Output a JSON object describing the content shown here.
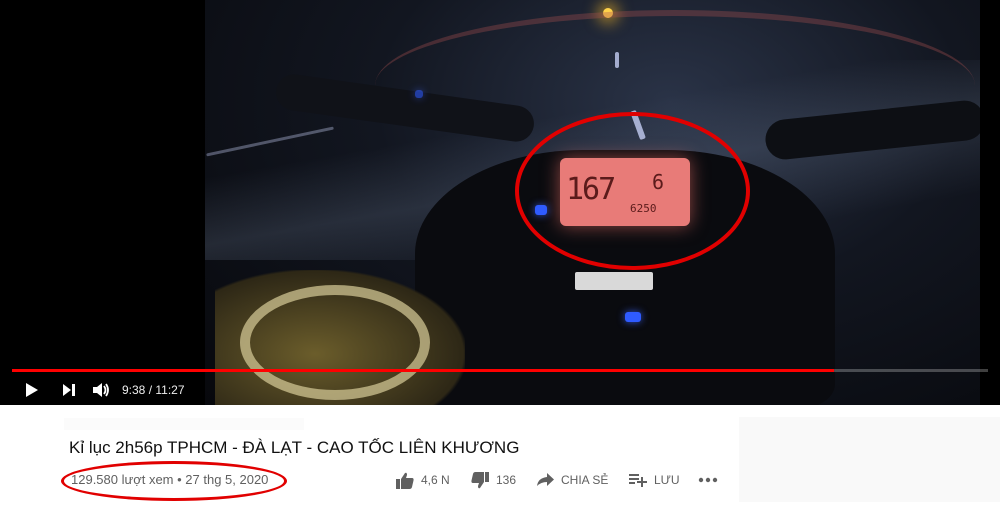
{
  "player": {
    "current_time": "9:38",
    "duration": "11:27",
    "time_display": "9:38 / 11:27",
    "progress_fraction": 0.842,
    "dashboard": {
      "speed": "167",
      "gear": "6",
      "rpm": "6250"
    }
  },
  "video": {
    "title": "Kỉ lục 2h56p TPHCM - ĐÀ LẠT - CAO TỐC LIÊN KHƯƠNG",
    "meta": "129.580 lượt xem • 27 thg 5, 2020"
  },
  "actions": {
    "like_count": "4,6 N",
    "dislike_count": "136",
    "share_label": "CHIA SẺ",
    "save_label": "LƯU"
  },
  "colors": {
    "accent": "#ff0000",
    "annotation": "#e10000",
    "text_secondary": "#606060"
  },
  "icons": [
    "play-icon",
    "next-icon",
    "volume-icon",
    "thumbs-up-icon",
    "thumbs-down-icon",
    "share-icon",
    "playlist-add-icon",
    "more-icon"
  ]
}
